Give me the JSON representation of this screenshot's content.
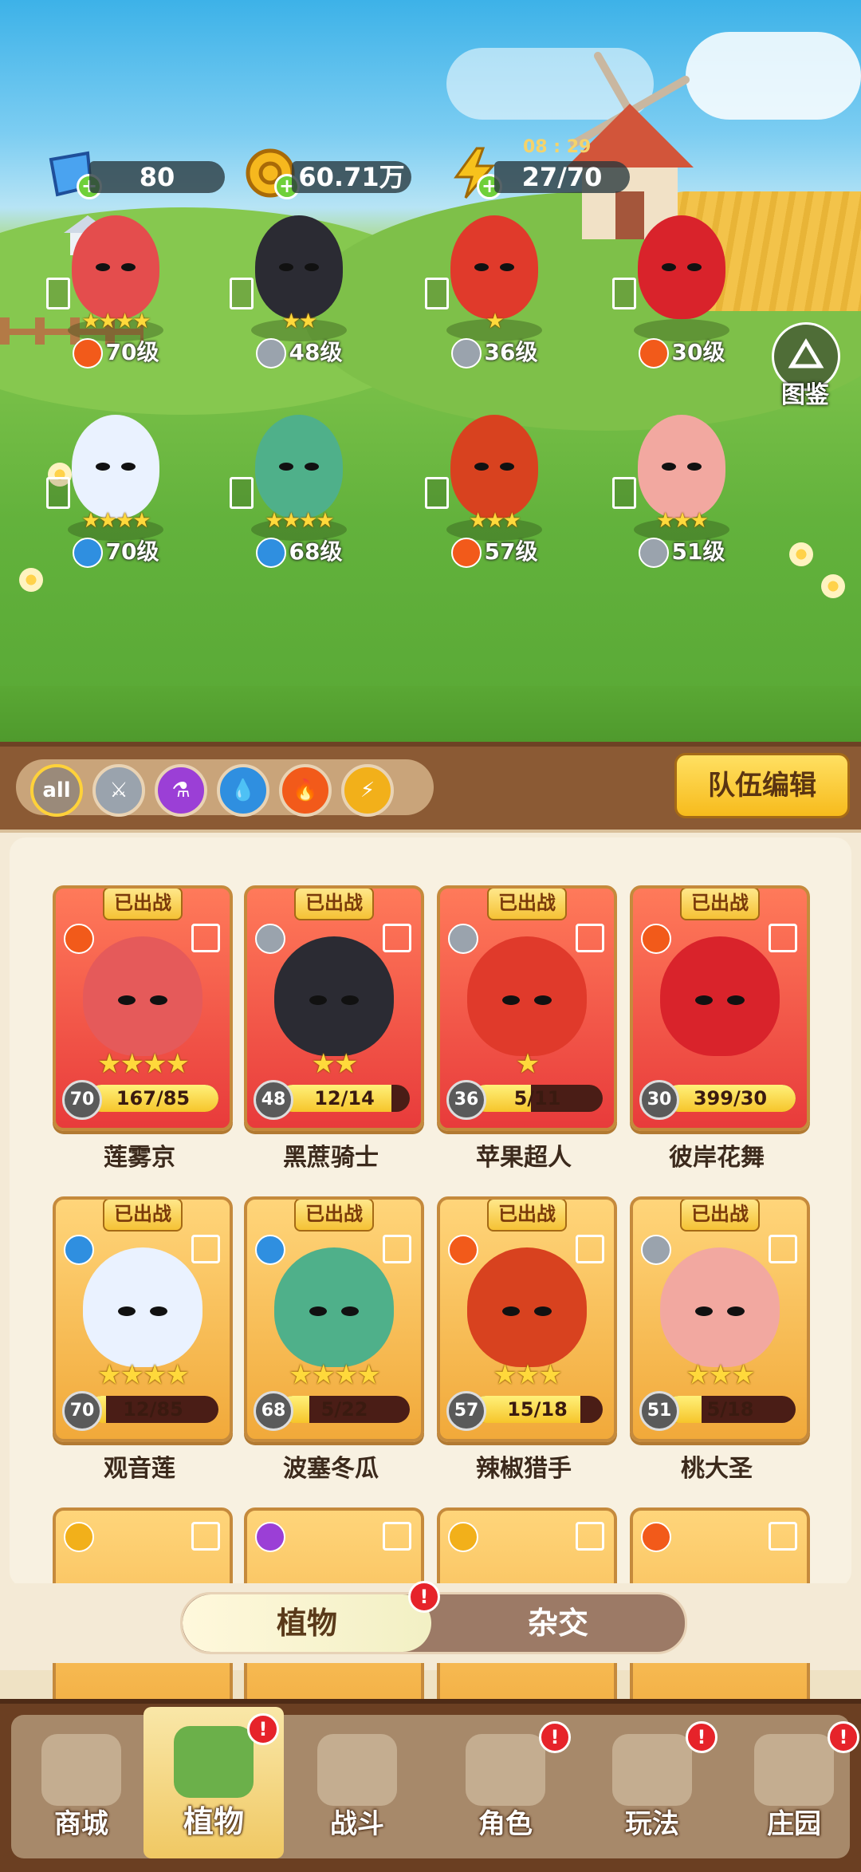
{
  "resources": {
    "gems": "80",
    "coins": "60.71万",
    "energy": "27/70",
    "energy_timer": "08 : 29"
  },
  "codex_label": "图鉴",
  "field_units": [
    {
      "stars": "★★★★",
      "level": "70级",
      "element": "fire",
      "color": "#e44d4d"
    },
    {
      "stars": "★★",
      "level": "48级",
      "element": "sword",
      "color": "#2b2b33"
    },
    {
      "stars": "★",
      "level": "36级",
      "element": "sword",
      "color": "#e03a2b"
    },
    {
      "stars": "",
      "level": "30级",
      "element": "fire",
      "color": "#d9232b"
    },
    {
      "stars": "★★★★",
      "level": "70级",
      "element": "water",
      "color": "#eaf2ff"
    },
    {
      "stars": "★★★★",
      "level": "68级",
      "element": "water",
      "color": "#4fb08a"
    },
    {
      "stars": "★★★",
      "level": "57级",
      "element": "fire",
      "color": "#d8421f"
    },
    {
      "stars": "★★★",
      "level": "51级",
      "element": "sword",
      "color": "#f2a8a0"
    }
  ],
  "filters": [
    "all",
    "sword",
    "potion",
    "water",
    "fire",
    "lightning"
  ],
  "filter_all_label": "all",
  "team_edit_button": "队伍编辑",
  "deployed_label": "已出战",
  "plants": [
    {
      "name": "莲雾京",
      "level": "70",
      "progress": "167/85",
      "fill": 1.0,
      "stars": "★★★★",
      "rarity": "red",
      "element": "fire",
      "color": "#e55a5a"
    },
    {
      "name": "黑蔗骑士",
      "level": "48",
      "progress": "12/14",
      "fill": 0.86,
      "stars": "★★",
      "rarity": "red",
      "element": "sword",
      "color": "#2b2b33"
    },
    {
      "name": "苹果超人",
      "level": "36",
      "progress": "5/11",
      "fill": 0.45,
      "stars": "★",
      "rarity": "red",
      "element": "sword",
      "color": "#e03a2b"
    },
    {
      "name": "彼岸花舞",
      "level": "30",
      "progress": "399/30",
      "fill": 1.0,
      "stars": "",
      "rarity": "red",
      "element": "fire",
      "color": "#d9232b"
    },
    {
      "name": "观音莲",
      "level": "70",
      "progress": "12/85",
      "fill": 0.14,
      "stars": "★★★★",
      "rarity": "gold",
      "element": "water",
      "color": "#eaf2ff"
    },
    {
      "name": "波塞冬瓜",
      "level": "68",
      "progress": "5/22",
      "fill": 0.23,
      "stars": "★★★★",
      "rarity": "gold",
      "element": "water",
      "color": "#4fb08a"
    },
    {
      "name": "辣椒猎手",
      "level": "57",
      "progress": "15/18",
      "fill": 0.83,
      "stars": "★★★",
      "rarity": "gold",
      "element": "fire",
      "color": "#d8421f"
    },
    {
      "name": "桃大圣",
      "level": "51",
      "progress": "5/18",
      "fill": 0.28,
      "stars": "★★★",
      "rarity": "gold",
      "element": "sword",
      "color": "#f2a8a0"
    }
  ],
  "peek_cards": [
    {
      "element": "lightning"
    },
    {
      "element": "potion"
    },
    {
      "element": "lightning"
    },
    {
      "element": "fire"
    }
  ],
  "toggle": {
    "left": "植物",
    "right": "杂交",
    "left_alert": "!"
  },
  "nav": [
    {
      "label": "商城",
      "alert": ""
    },
    {
      "label": "植物",
      "alert": "!"
    },
    {
      "label": "战斗",
      "alert": ""
    },
    {
      "label": "角色",
      "alert": "!"
    },
    {
      "label": "玩法",
      "alert": "!"
    },
    {
      "label": "庄园",
      "alert": "!"
    }
  ],
  "element_colors": {
    "fire": "#f25a1a",
    "water": "#2f8fe0",
    "sword": "#9aa3ad",
    "potion": "#9b3fd6",
    "lightning": "#f2b01a"
  }
}
